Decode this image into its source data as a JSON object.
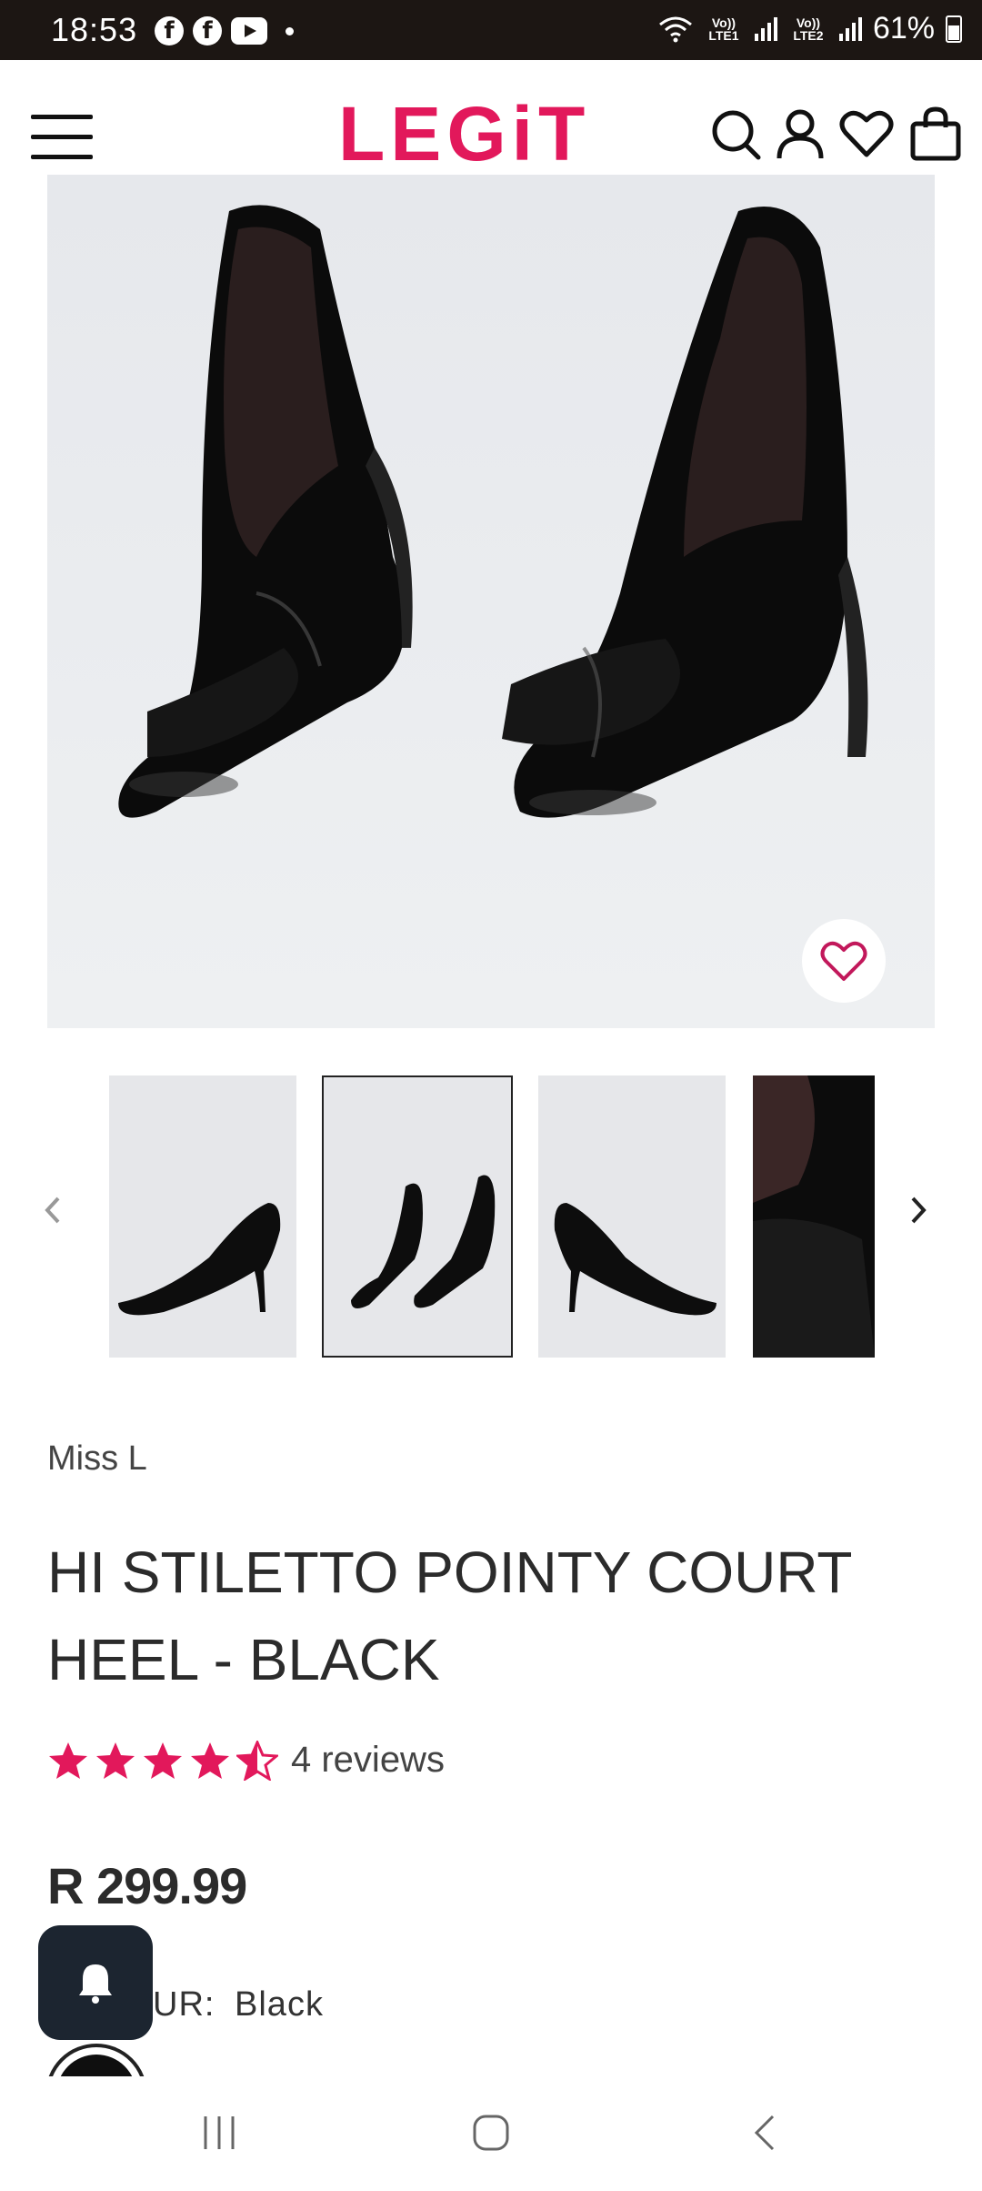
{
  "status_bar": {
    "time": "18:53",
    "battery": "61%",
    "sim1": "Vo)) LTE1",
    "sim2": "Vo)) LTE2"
  },
  "header": {
    "logo": "LEGiT",
    "icons": [
      "menu-icon",
      "search-icon",
      "account-icon",
      "wishlist-icon",
      "cart-icon"
    ],
    "accent_color": "#e2185b"
  },
  "product": {
    "brand": "Miss L",
    "title": "HI STILETTO POINTY COURT HEEL - BLACK",
    "rating": 4.5,
    "rating_max": 5,
    "reviews_label": "4 reviews",
    "price": "R 299.99",
    "colour_label": "UR:",
    "colour_value": "Black"
  },
  "gallery": {
    "selected_index": 1,
    "thumbnails": [
      "side-view",
      "front-pair",
      "other-side-view",
      "detail-closeup"
    ]
  },
  "nav": {
    "icons": [
      "recent-apps-icon",
      "home-icon",
      "back-icon"
    ]
  }
}
